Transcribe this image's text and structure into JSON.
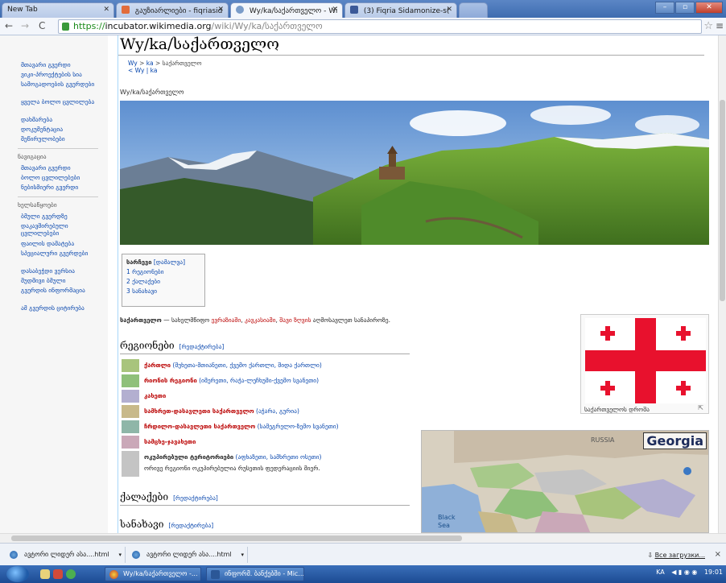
{
  "tabs": [
    {
      "label": "New Tab",
      "active": false
    },
    {
      "label": "გაუზიარლიები - fiqriasid",
      "active": false
    },
    {
      "label": "Wy/ka/საქართველო - Wi",
      "active": true
    },
    {
      "label": "(3) Fiqria Sidamonize-s(",
      "active": false
    }
  ],
  "address": {
    "scheme": "https://",
    "host": "incubator.wikimedia.org",
    "path": "/wiki/Wy/ka/საქართველო"
  },
  "sidebar": {
    "items": [
      "მთავარი გვერდი",
      "ვიკი-პროექტების სია",
      "სამოგადოების გვერდები",
      "ყველა ბოლო ცვლილება",
      "დახმარება",
      "დოკუმენტაცია",
      "შეწირულობები"
    ],
    "head1": "ნავიგაცია",
    "items2": [
      "მთავარი გვერდი",
      "ბოლო ცვლილებები",
      "ნებისმიერი გვერდი"
    ],
    "head2": "ხელსაწყოები",
    "items3": [
      "ბმული გვერდზე",
      "დაკავშირებული ცვლილებები",
      "ფაილის დამატება",
      "სპეციალური გვერდები",
      "დასაბეჭდი ვერსია",
      "მუდმივი ბმული",
      "გვერდის ინფორმაცია",
      "ამ გვერდის ციტირება"
    ]
  },
  "page": {
    "title": "Wy/ka/საქართველო",
    "crumb_path": "Wy",
    "crumb_sep": " > ",
    "crumb_lang": "ka",
    "crumb_tail": " > საქართველო",
    "crumb_back": "< Wy | ka",
    "subtitle": "Wy/ka/საქართველო",
    "toc_title": "სარჩევი",
    "toc_toggle": "[დამალვა]",
    "toc_items": [
      "1 რეგიონები",
      "2 ქალაქები",
      "3 სანახავი"
    ],
    "intro_bold": "საქართველო",
    "intro_text": " — სახელმწიფო ",
    "intro_link1": "ევრაზიაში",
    "intro_comma": ", ",
    "intro_link2": "კავკასიაში",
    "intro_comma2": ", ",
    "intro_link3": "შავი ზღვის",
    "intro_end": " აღმოსავლეთ სანაპიროზე.",
    "h_regions": "რეგიონები",
    "h_cities": "ქალაქები",
    "h_see": "სანახავი",
    "edit_label": "[რედაქტირება]",
    "flag_caption": "საქართველოს დროშა",
    "map_title": "Georgia"
  },
  "regions": [
    {
      "name": "ქართლი",
      "sub": " (შუხეთა-მთიანეთი, ქვემო ქართლი, შიდა ქართლი)",
      "color": "#a8c47c",
      "bold_black": false
    },
    {
      "name": "რიონის რეგიონი",
      "sub": " (იმერეთი, რაჭა-ლეჩხუმი-ქვემო სვანეთი)",
      "color": "#8fc07a",
      "bold_black": false
    },
    {
      "name": "კახეთი",
      "sub": "",
      "color": "#b3afd0",
      "bold_black": false
    },
    {
      "name": "სამხრეთ-დასავლეთი საქართველო",
      "sub": " (აჭარა, გურია)",
      "color": "#c8b98a",
      "bold_black": false
    },
    {
      "name": "ჩრდილო-დასავლეთი საქართველო",
      "sub": " (სამეგრელო-ზემო სვანეთი)",
      "color": "#8fb6a8",
      "bold_black": false
    },
    {
      "name": "სამცხე-ჯავახეთი",
      "sub": "",
      "color": "#caa8b8",
      "bold_black": false
    },
    {
      "name": "ოკუპირებული ტერიტორიები",
      "sub": " (აფხაზეთი, სამხრეთი ოსეთი)",
      "color": "#c4c4c4",
      "bold_black": true
    }
  ],
  "region_note": "ორივე რეგიონი ოკუპირებულია რუსეთის ფედერაციის მიერ.",
  "region_note_link": "რუსეთის ფედერაციის",
  "downloads": {
    "items": [
      "ავტორი ლიდერ ასა....html",
      "ავტორი ლიდერ ასა....html"
    ],
    "all": "Все загрузки...",
    "close": "×"
  },
  "taskbar": {
    "tasks": [
      "Wy/ka/საქართველო -...",
      "ინფორმ. ბანქებში - Mic..."
    ],
    "tray_lang": "KA",
    "clock": "19:01"
  },
  "colors": {
    "link": "#0645ad",
    "redlink": "#ba0000",
    "flag_red": "#e8112d"
  }
}
